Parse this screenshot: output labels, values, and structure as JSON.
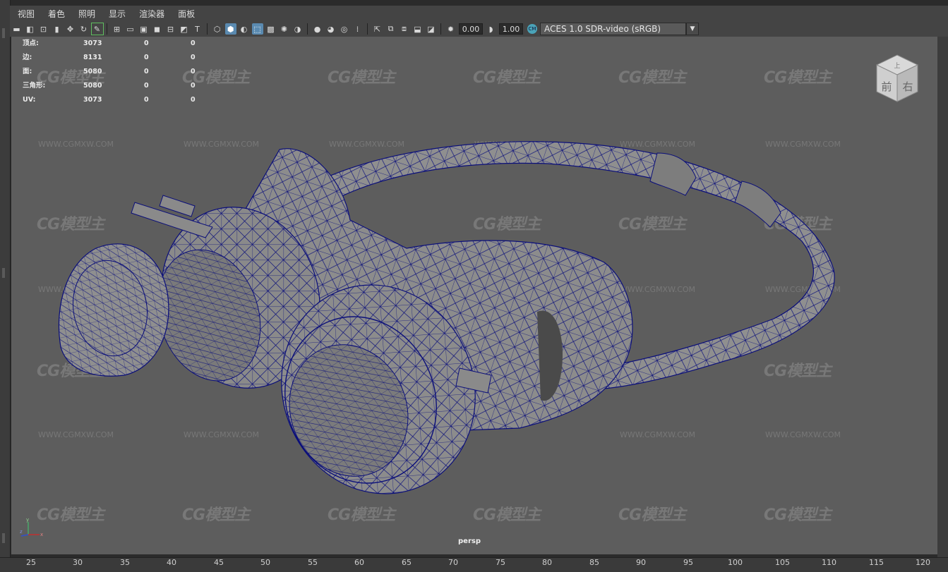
{
  "menu": [
    "视图",
    "着色",
    "照明",
    "显示",
    "渲染器",
    "面板"
  ],
  "toolbar": {
    "icons_a": [
      "camera-icon",
      "camera-attr-icon",
      "bookmark-icon",
      "image-plane-icon",
      "2d-pan-icon",
      "grease-pencil-icon"
    ],
    "icons_b": [
      "grid-icon",
      "film-gate-icon",
      "resolution-gate-icon",
      "gate-mask-icon",
      "field-chart-icon",
      "safe-action-icon",
      "safe-title-icon"
    ],
    "icons_c": [
      "wireframe-icon",
      "smooth-shade-icon",
      "default-material-icon",
      "wireframe-on-shaded-icon",
      "textured-icon",
      "use-lights-icon",
      "shadows-icon"
    ],
    "icons_d": [
      "ambient-occlusion-icon",
      "motion-blur-icon",
      "multisample-aa-icon",
      "depth-of-field-icon"
    ],
    "icons_e": [
      "isolate-select-icon",
      "xray-icon",
      "xray-active-icon",
      "xray-joints-icon",
      "backface-icon"
    ],
    "exposure_value": "0.00",
    "gamma_value": "1.00",
    "colorspace_badge": "CM",
    "colorspace": "ACES 1.0 SDR-video (sRGB)"
  },
  "hud": {
    "rows": [
      {
        "label": "顶点:",
        "v1": "3073",
        "v2": "0",
        "v3": "0"
      },
      {
        "label": "边:",
        "v1": "8131",
        "v2": "0",
        "v3": "0"
      },
      {
        "label": "面:",
        "v1": "5080",
        "v2": "0",
        "v3": "0"
      },
      {
        "label": "三角形:",
        "v1": "5080",
        "v2": "0",
        "v3": "0"
      },
      {
        "label": "UV:",
        "v1": "3073",
        "v2": "0",
        "v3": "0"
      }
    ]
  },
  "navcube": {
    "front": "前",
    "right": "右",
    "top": "上"
  },
  "camera": "persp",
  "axis": {
    "x": "x",
    "y": "y",
    "z": "z"
  },
  "watermark": {
    "logo": "CG模型主",
    "url": "WWW.CGMXW.COM"
  },
  "timeline": {
    "ticks": [
      "25",
      "30",
      "35",
      "40",
      "45",
      "50",
      "55",
      "60",
      "65",
      "70",
      "75",
      "80",
      "85",
      "90",
      "95",
      "100",
      "105",
      "110",
      "115",
      "120"
    ]
  },
  "colors": {
    "viewport_bg": "#5d5d5d",
    "wire": "#0b0f7a",
    "mesh": "#8a8a8a",
    "highlight": "#5a8ab0"
  }
}
